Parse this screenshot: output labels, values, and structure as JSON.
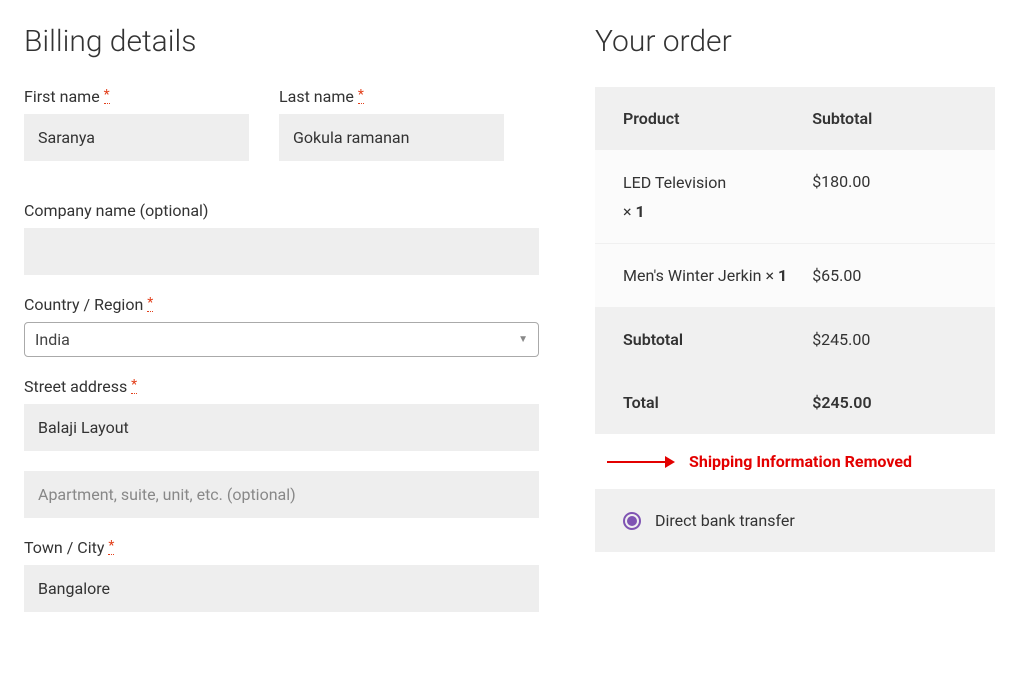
{
  "billing": {
    "heading": "Billing details",
    "first_name": {
      "label": "First name",
      "required": "*",
      "value": "Saranya"
    },
    "last_name": {
      "label": "Last name",
      "required": "*",
      "value": "Gokula ramanan"
    },
    "company": {
      "label": "Company name (optional)",
      "value": ""
    },
    "country": {
      "label": "Country / Region",
      "required": "*",
      "selected": "India"
    },
    "street": {
      "label": "Street address",
      "required": "*",
      "value": "Balaji Layout",
      "placeholder2": "Apartment, suite, unit, etc. (optional)",
      "value2": ""
    },
    "city": {
      "label": "Town / City",
      "required": "*",
      "value": "Bangalore"
    }
  },
  "order": {
    "heading": "Your order",
    "header_product": "Product",
    "header_subtotal": "Subtotal",
    "items": [
      {
        "name": "LED Television",
        "qty_prefix": "×",
        "qty": "1",
        "price": "$180.00"
      },
      {
        "name": "Men's Winter Jerkin",
        "qty_prefix": "×",
        "qty": "1",
        "price": "$65.00"
      }
    ],
    "subtotal_label": "Subtotal",
    "subtotal_value": "$245.00",
    "total_label": "Total",
    "total_value": "$245.00",
    "annotation": "Shipping Information Removed",
    "payment": {
      "option1": "Direct bank transfer"
    }
  }
}
